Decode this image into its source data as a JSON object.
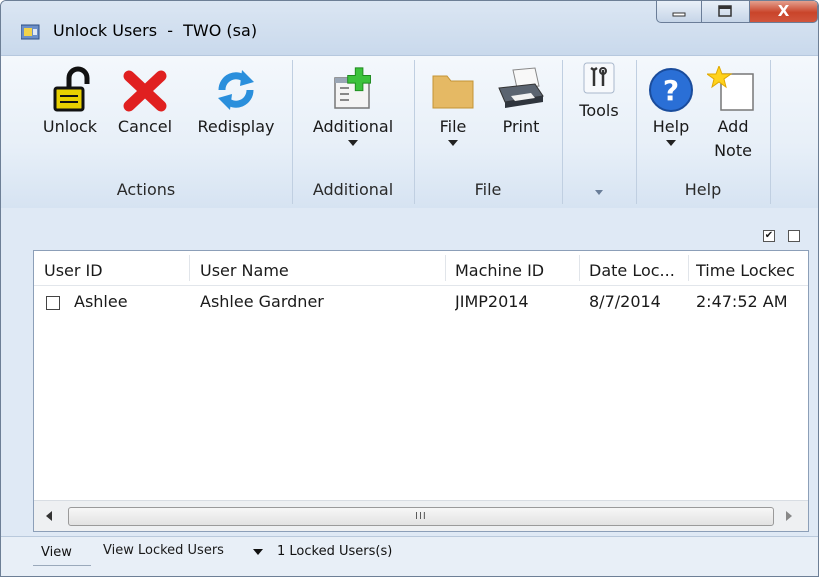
{
  "window": {
    "title": "Unlock Users  -  TWO (sa)",
    "close_glyph": "X"
  },
  "ribbon": {
    "groups": {
      "actions": {
        "label": "Actions",
        "unlock": "Unlock",
        "cancel": "Cancel",
        "redisplay": "Redisplay"
      },
      "additional": {
        "label": "Additional",
        "additional": "Additional"
      },
      "file": {
        "label": "File",
        "file": "File",
        "print": "Print"
      },
      "tools": {
        "tools": "Tools"
      },
      "help": {
        "label": "Help",
        "help": "Help",
        "add_note_line1": "Add",
        "add_note_line2": "Note"
      }
    }
  },
  "grid": {
    "columns": [
      "User ID",
      "User Name",
      "Machine ID",
      "Date Loc...",
      "Time Lockec"
    ],
    "rows": [
      {
        "user_id": "Ashlee",
        "user_name": "Ashlee Gardner",
        "machine_id": "JIMP2014",
        "date": "8/7/2014",
        "time": "2:47:52 AM"
      }
    ],
    "scroll_grip": "III"
  },
  "status": {
    "view_label": "View",
    "view_value": "View Locked Users",
    "count_text": "1 Locked Users(s)"
  },
  "colors": {
    "accent_blue": "#2a6fd6",
    "cancel_red": "#e02020",
    "lock_yellow": "#e8d000"
  }
}
